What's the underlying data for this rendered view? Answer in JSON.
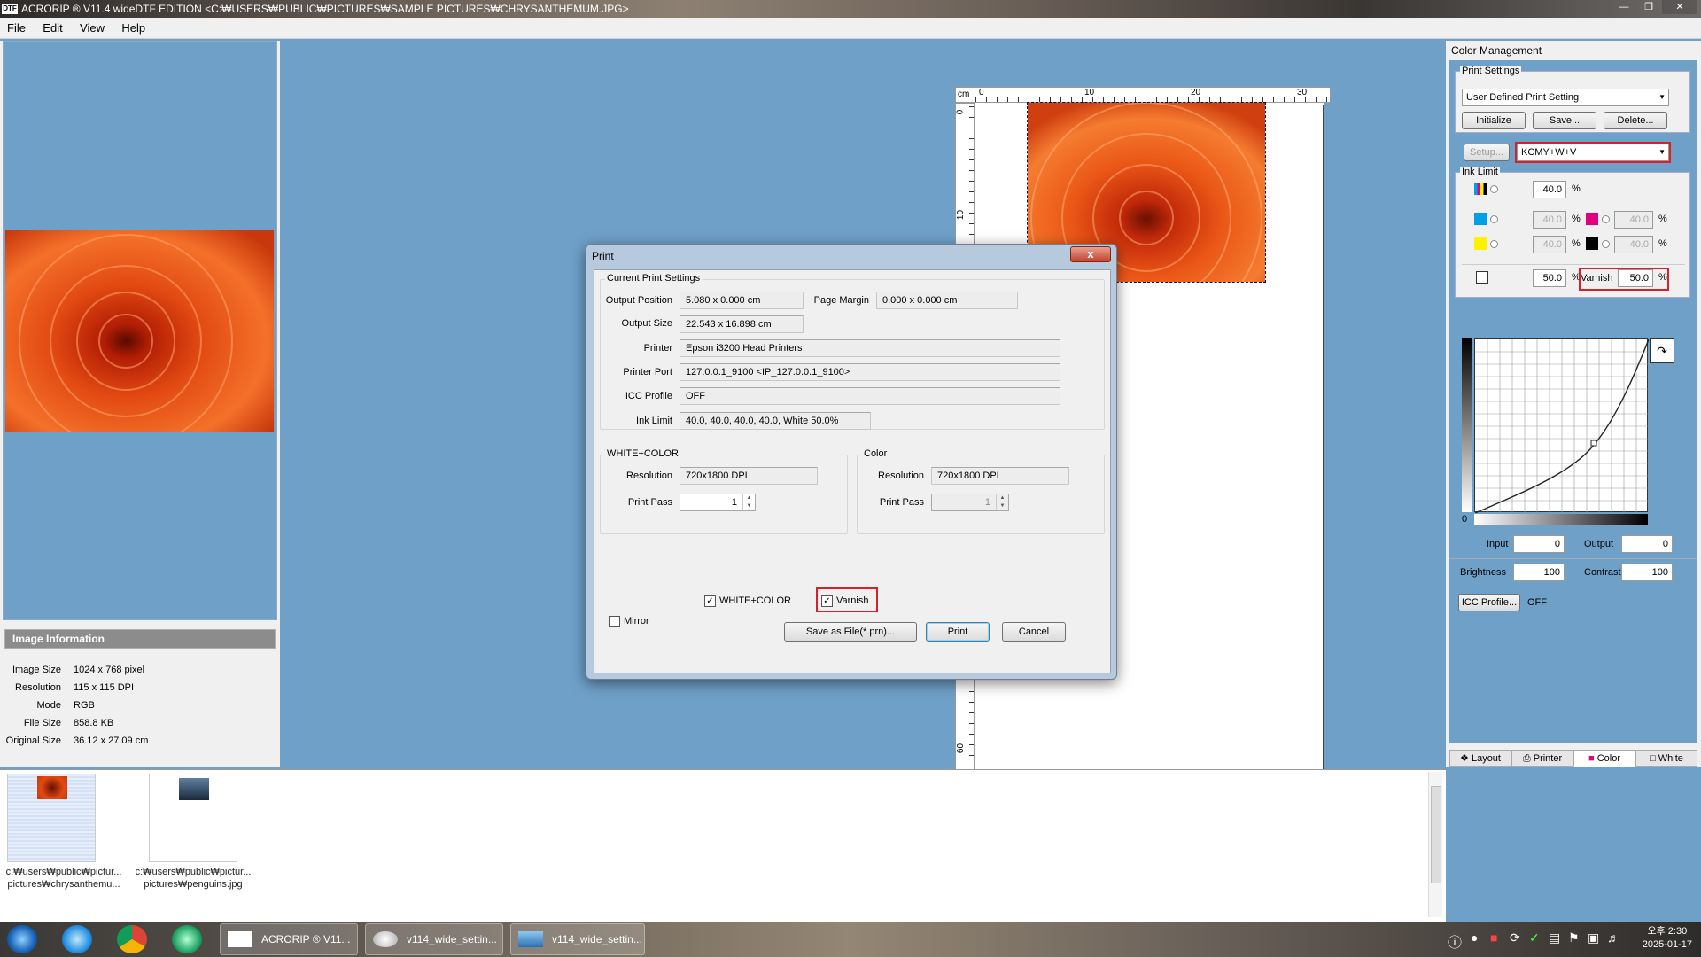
{
  "window": {
    "logo": "DTF",
    "title": "ACRORIP ® V11.4 wideDTF EDITION <C:₩USERS₩PUBLIC₩PICTURES₩SAMPLE PICTURES₩CHRYSANTHEMUM.JPG>"
  },
  "menu": [
    "File",
    "Edit",
    "View",
    "Help"
  ],
  "image_info": {
    "header": "Image Information",
    "rows": [
      {
        "k": "Image Size",
        "v": "1024 x 768 pixel"
      },
      {
        "k": "Resolution",
        "v": "115 x 115 DPI"
      },
      {
        "k": "Mode",
        "v": "RGB"
      },
      {
        "k": "File Size",
        "v": "858.8 KB"
      },
      {
        "k": "Original Size",
        "v": "36.12 x 27.09 cm"
      }
    ]
  },
  "ruler": {
    "unit": "cm",
    "top_ticks": [
      "0",
      "10",
      "20",
      "30"
    ],
    "left_ticks": [
      "0",
      "10",
      "60"
    ]
  },
  "dialog": {
    "title": "Print",
    "current_group": "Current Print Settings",
    "output_position_label": "Output Position",
    "output_position": "5.080 x 0.000 cm",
    "page_margin_label": "Page Margin",
    "page_margin": "0.000 x 0.000 cm",
    "output_size_label": "Output Size",
    "output_size": "22.543 x 16.898 cm",
    "printer_label": "Printer",
    "printer": "Epson i3200 Head Printers",
    "printer_port_label": "Printer Port",
    "printer_port": "127.0.0.1_9100  <IP_127.0.0.1_9100>",
    "icc_label": "ICC Profile",
    "icc": "OFF",
    "ink_limit_label": "Ink Limit",
    "ink_limit": "40.0, 40.0, 40.0, 40.0, White 50.0%",
    "wc_group": "WHITE+COLOR",
    "wc_resolution_label": "Resolution",
    "wc_resolution": "720x1800 DPI",
    "wc_pass_label": "Print Pass",
    "wc_pass": "1",
    "color_group": "Color",
    "color_resolution_label": "Resolution",
    "color_resolution": "720x1800 DPI",
    "color_pass_label": "Print Pass",
    "color_pass": "1",
    "chk_wc": "WHITE+COLOR",
    "chk_varnish": "Varnish",
    "chk_mirror": "Mirror",
    "btn_save": "Save as File(*.prn)...",
    "btn_print": "Print",
    "btn_cancel": "Cancel",
    "close": "x"
  },
  "color_mgmt": {
    "title": "Color Management",
    "print_settings_label": "Print Settings",
    "print_setting": "User Defined Print Setting",
    "btn_initialize": "Initialize",
    "btn_save": "Save...",
    "btn_delete": "Delete...",
    "btn_setup": "Setup...",
    "ink_mode": "KCMY+W+V",
    "ink_limit_label": "Ink Limit",
    "ink_all": "40.0",
    "ink_c": "40.0",
    "ink_m": "40.0",
    "ink_y": "40.0",
    "ink_k": "40.0",
    "ink_white": "50.0",
    "varnish_label": "Varnish",
    "ink_varnish": "50.0",
    "pct": "%",
    "curve_zero": "0",
    "input_label": "Input",
    "input_val": "0",
    "output_label": "Output",
    "output_val": "0",
    "brightness_label": "Brightness",
    "brightness_val": "100",
    "contrast_label": "Contrast",
    "contrast_val": "100",
    "btn_icc": "ICC Profile...",
    "icc_state": "OFF",
    "tabs": [
      "Layout",
      "Printer",
      "Color",
      "White"
    ]
  },
  "thumbnails": [
    {
      "line1": "c:₩users₩public₩pictur...",
      "line2": "pictures₩chrysanthemu..."
    },
    {
      "line1": "c:₩users₩public₩pictur...",
      "line2": "pictures₩penguins.jpg"
    }
  ],
  "taskbar": {
    "tasks": [
      "ACRORIP ® V11...",
      "v114_wide_settin...",
      "v114_wide_settin..."
    ],
    "clock_time": "오후 2:30",
    "clock_date": "2025-01-17"
  },
  "colors": {
    "cyan": "#00a0e9",
    "magenta": "#e4007f",
    "yellow": "#fff100",
    "black": "#000000",
    "highlight": "#d8202a",
    "workspace": "#6fa0c8"
  }
}
